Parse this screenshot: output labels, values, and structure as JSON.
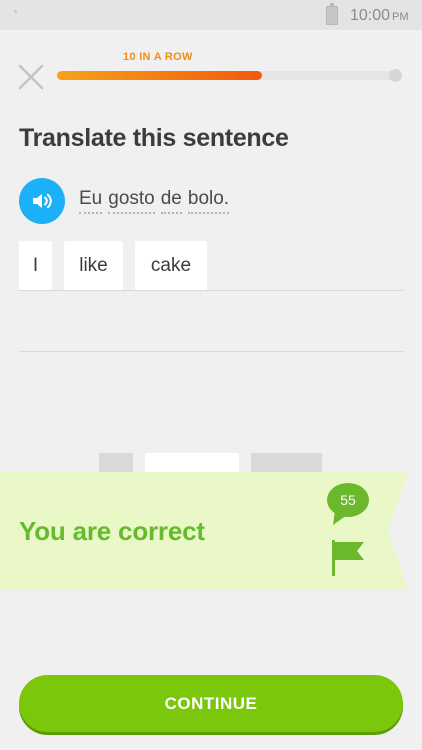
{
  "status_bar": {
    "time": "10:00",
    "ampm": "PM",
    "battery_icon": "battery-icon"
  },
  "header": {
    "close_icon": "close-icon",
    "streak_label": "10 IN A ROW",
    "progress_fraction": 0.6,
    "progress_colors": [
      "#f6a21a",
      "#f05a0e"
    ]
  },
  "prompt": {
    "heading": "Translate this sentence",
    "speaker_icon": "speaker-icon",
    "source_words": [
      "Eu",
      "gosto",
      "de",
      "bolo."
    ]
  },
  "answer": {
    "chips": [
      "I",
      "like",
      "cake"
    ]
  },
  "result": {
    "message": "You are correct",
    "discussion_count": "55",
    "flag_icon": "flag-icon",
    "banner_color": "#eaf8c8",
    "text_color": "#66bb2c"
  },
  "footer": {
    "continue_label": "CONTINUE",
    "button_color": "#7ac70c"
  }
}
